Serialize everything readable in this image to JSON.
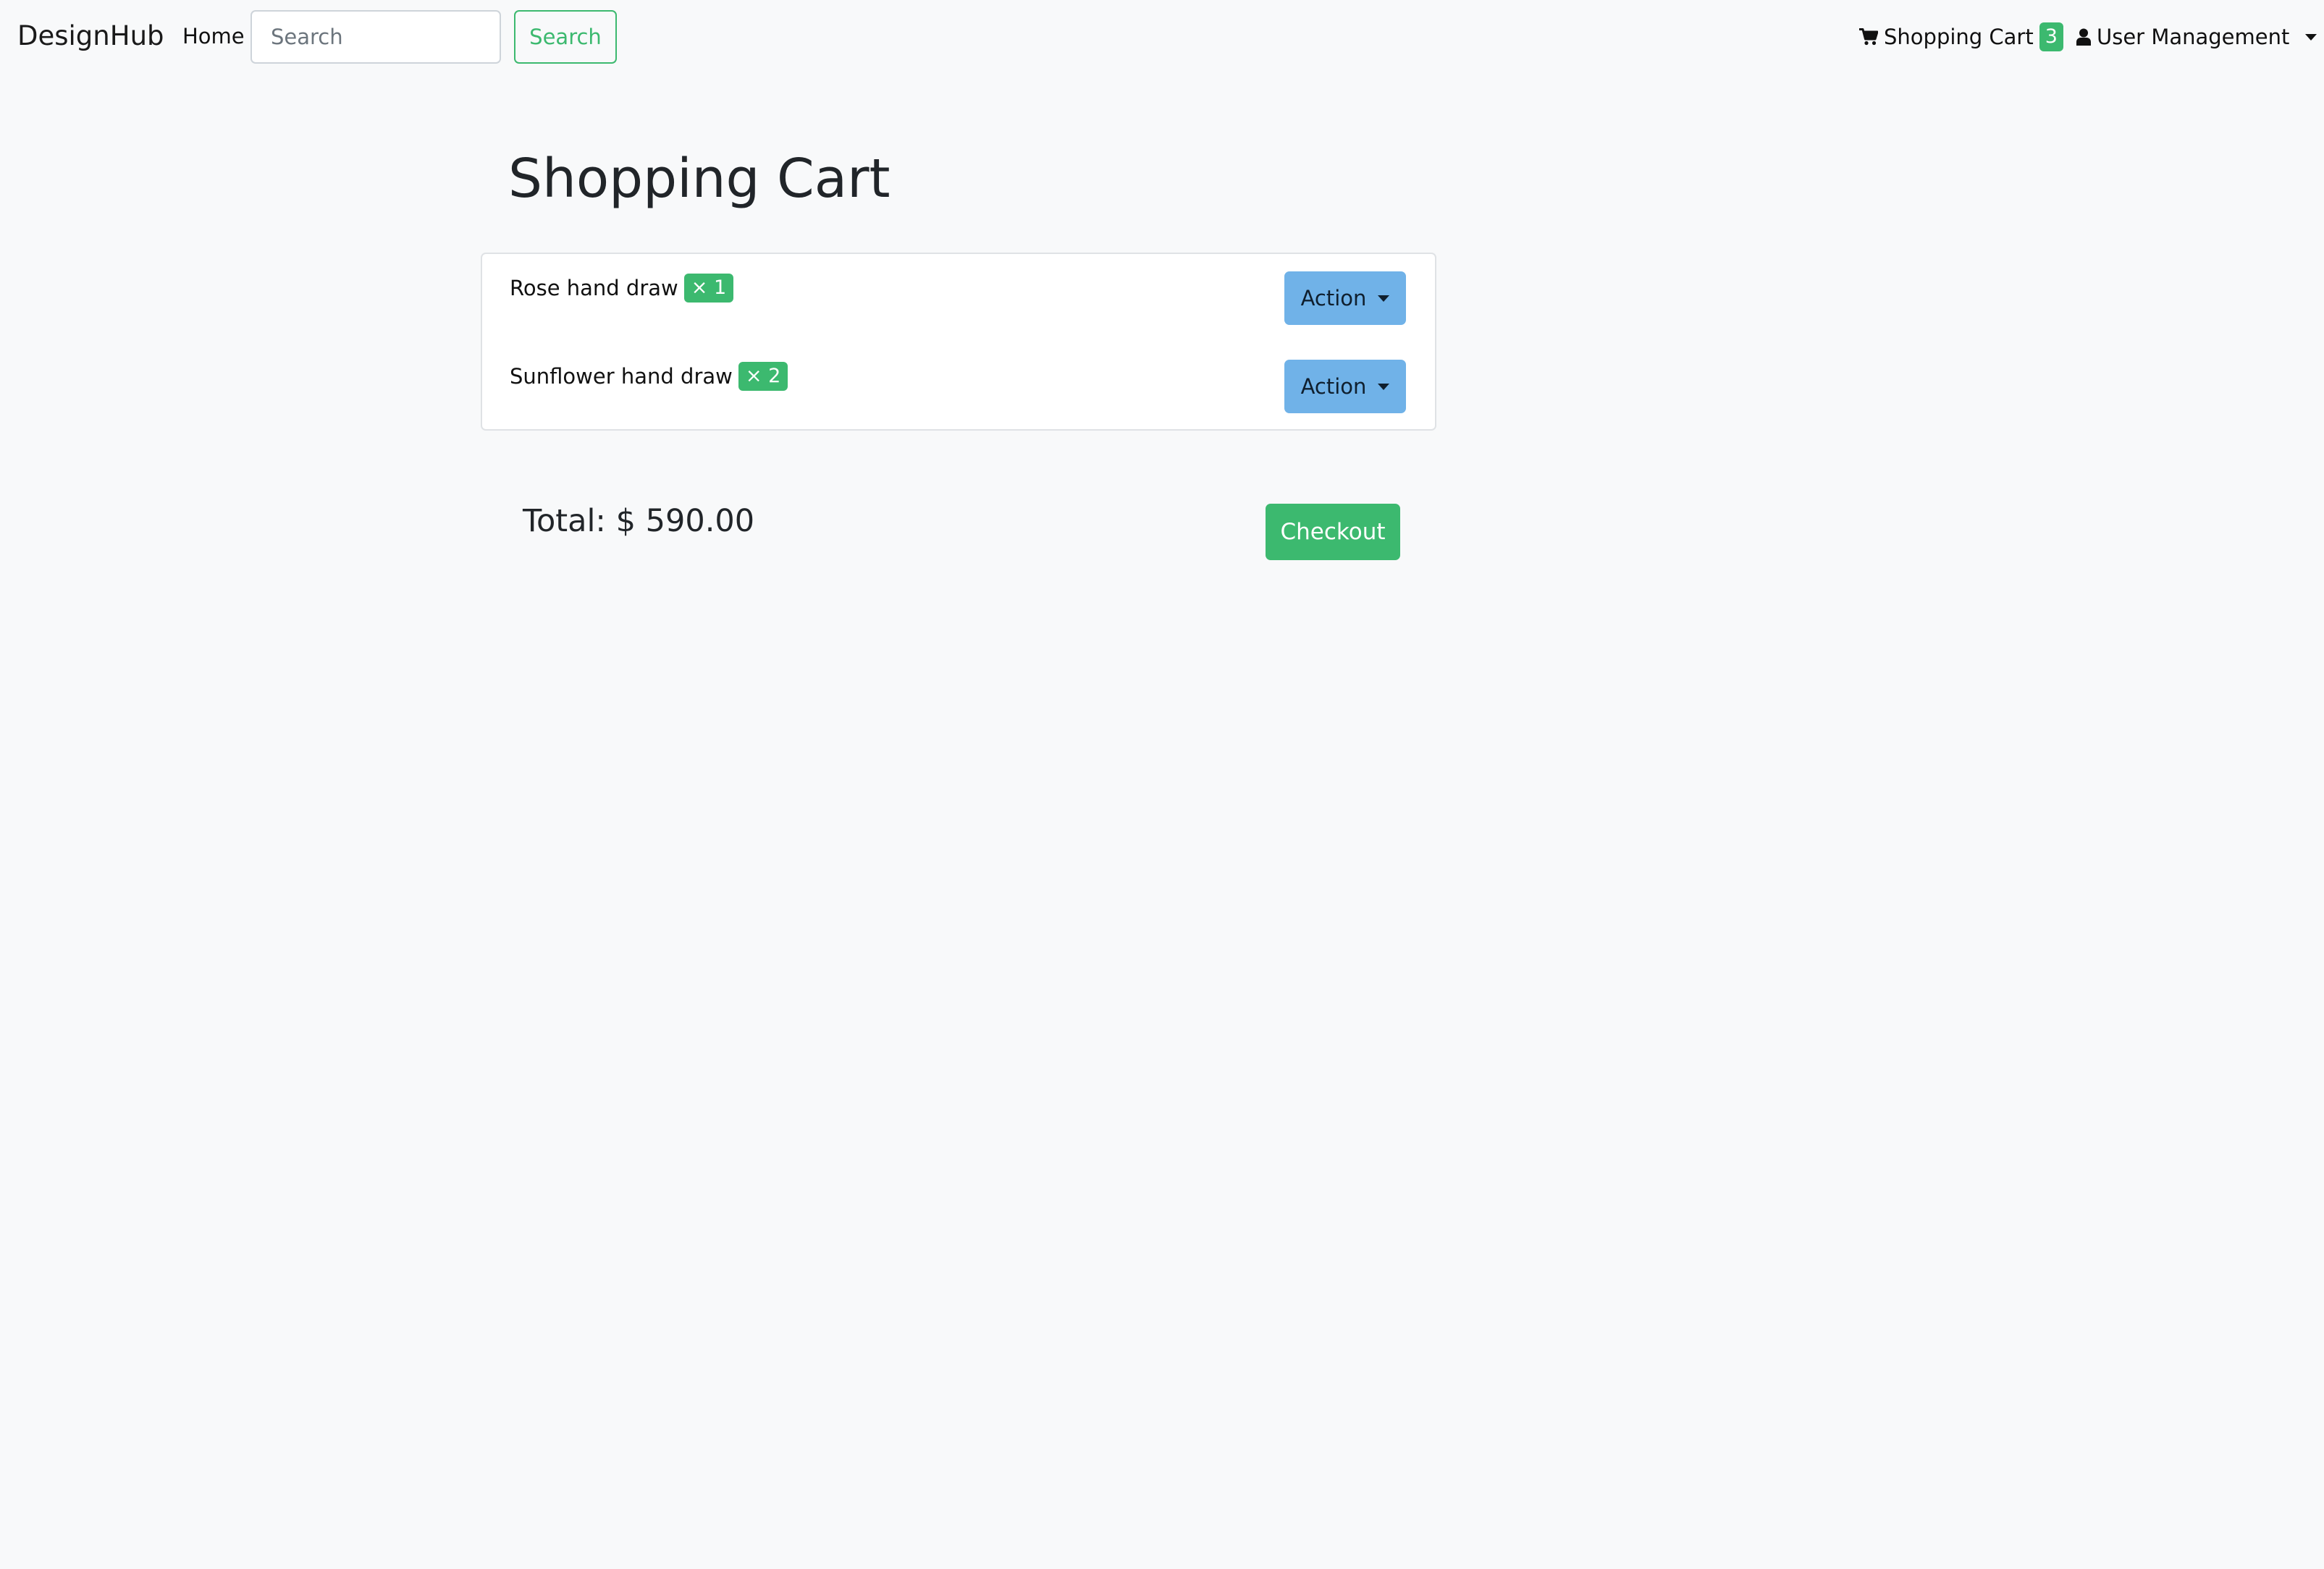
{
  "navbar": {
    "brand": "DesignHub",
    "home_label": "Home",
    "search_placeholder": "Search",
    "search_button_label": "Search",
    "cart_label": "Shopping Cart",
    "cart_count": "3",
    "cart_icon": "shopping-cart-icon",
    "user_label": "User Management",
    "user_icon": "user-icon"
  },
  "main": {
    "title": "Shopping Cart",
    "items": [
      {
        "name": "Rose hand draw",
        "qty": "× 1",
        "action_label": "Action"
      },
      {
        "name": "Sunflower hand draw",
        "qty": "× 2",
        "action_label": "Action"
      }
    ],
    "total_label": "Total:",
    "total_value": "$ 590.00",
    "checkout_label": "Checkout"
  },
  "colors": {
    "background": "#f8f9fa",
    "accent_green": "#3cb96f",
    "action_blue": "#70b2e8",
    "text_dark": "#212529"
  }
}
